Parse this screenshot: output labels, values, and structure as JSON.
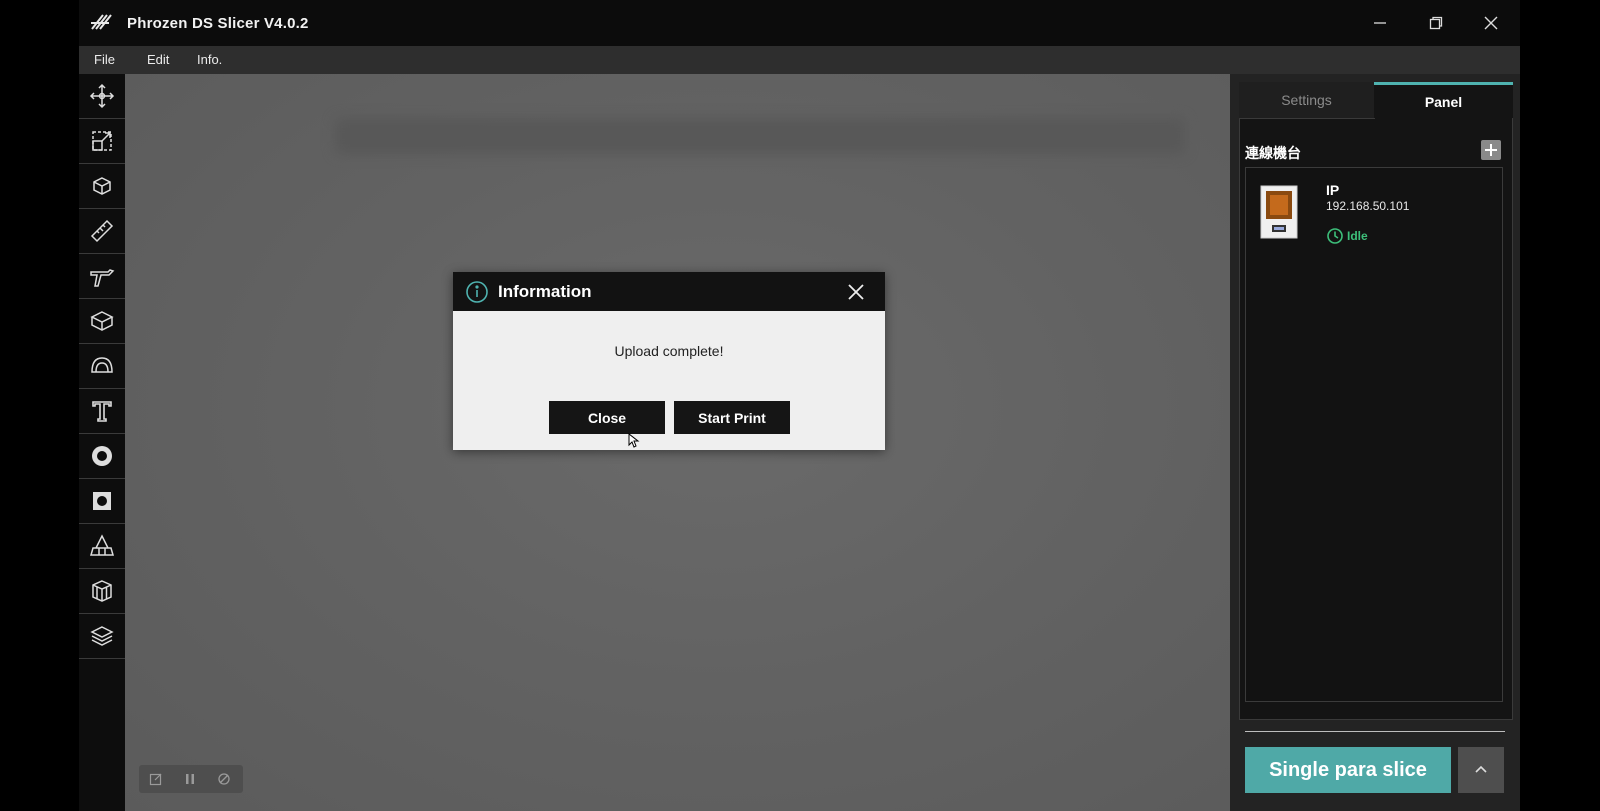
{
  "window": {
    "title": "Phrozen DS Slicer  V4.0.2",
    "controls": [
      "minimize-icon",
      "restore-icon",
      "close-icon"
    ]
  },
  "menu": {
    "items": [
      "File",
      "Edit",
      "Info."
    ]
  },
  "toolbar": {
    "tools": [
      "move-icon",
      "scale-icon",
      "rotate-icon",
      "measure-icon",
      "support-icon",
      "layout-icon",
      "hollow-icon",
      "text-icon",
      "ring-icon",
      "square-hole-icon",
      "base-icon",
      "cube-icon",
      "layers-icon"
    ]
  },
  "viewport_mini_tools": [
    "edit-icon",
    "pause-icon",
    "refresh-icon"
  ],
  "dialog": {
    "title": "Information",
    "message": "Upload complete!",
    "close_label": "Close",
    "start_label": "Start Print"
  },
  "panel": {
    "tabs": [
      "Settings",
      "Panel"
    ],
    "active_tab": "Panel",
    "section_title": "連線機台",
    "printer": {
      "name": "IP",
      "ip": "192.168.50.101",
      "status": "Idle"
    },
    "slice_label": "Single para slice"
  },
  "colors": {
    "accent": "#4fa9a7",
    "idle": "#3dbf7a",
    "tab_active": "#4fb3b0"
  }
}
